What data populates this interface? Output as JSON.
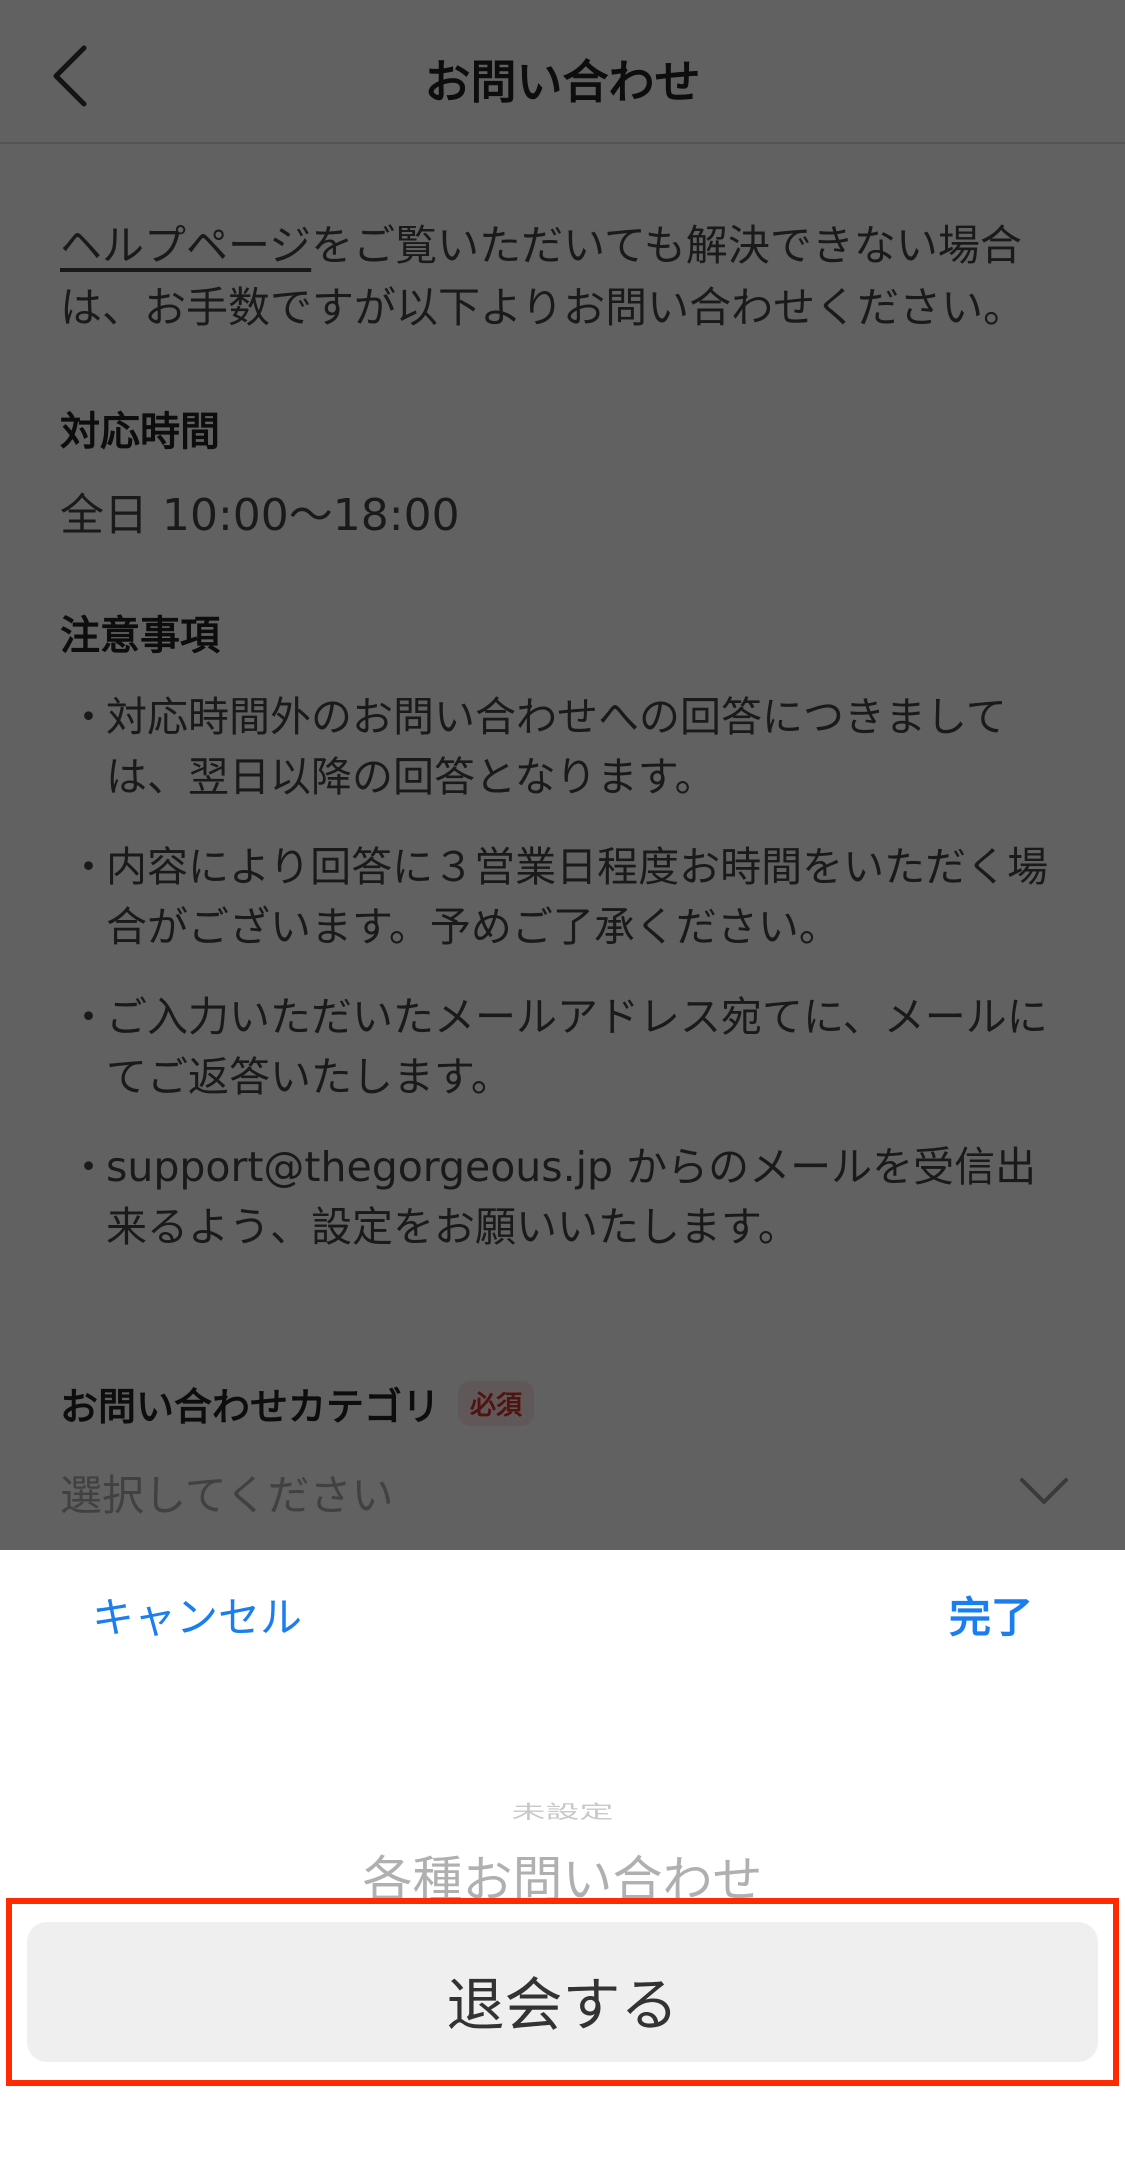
{
  "navbar": {
    "title": "お問い合わせ"
  },
  "intro": {
    "link_text": "ヘルプページ",
    "rest_text": "をご覧いただいても解決できない場合は、お手数ですが以下よりお問い合わせください。"
  },
  "hours_section": {
    "heading": "対応時間",
    "value": "全日 10:00～18:00"
  },
  "notes_section": {
    "heading": "注意事項",
    "bullet": "・",
    "items": [
      "対応時間外のお問い合わせへの回答につきましては、翌日以降の回答となります。",
      "内容により回答に３営業日程度お時間をいただく場合がございます。予めご了承ください。",
      "ご入力いただいたメールアドレス宛てに、メールにてご返答いたします。",
      "support@thegorgeous.jp からのメールを受信出来るよう、設定をお願いいたします。"
    ]
  },
  "category_field": {
    "label": "お問い合わせカテゴリ",
    "required_badge": "必須",
    "placeholder": "選択してください"
  },
  "picker": {
    "cancel_label": "キャンセル",
    "done_label": "完了",
    "options": [
      "未設定",
      "各種お問い合わせ",
      "退会する"
    ],
    "selected": "退会する"
  },
  "colors": {
    "accent": "#1a7df0",
    "required": "#d0342c",
    "highlight": "#ff2a00"
  }
}
